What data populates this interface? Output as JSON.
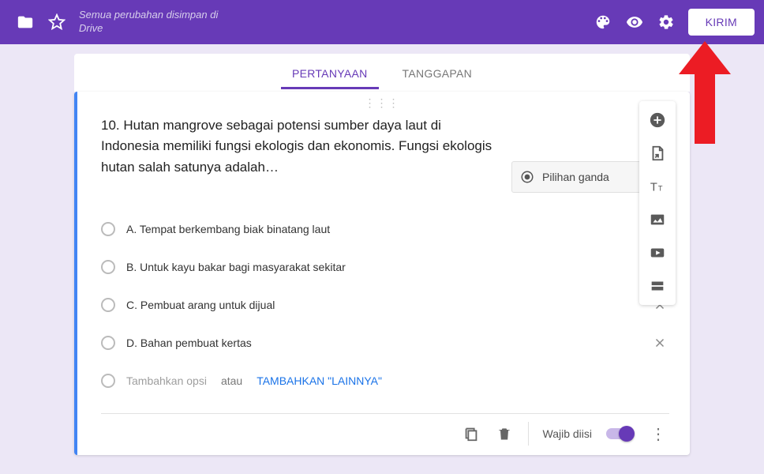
{
  "header": {
    "status_text": "Semua perubahan disimpan di Drive",
    "send_label": "KIRIM"
  },
  "tabs": {
    "questions": "PERTANYAAN",
    "responses": "TANGGAPAN"
  },
  "question": {
    "text": "10. Hutan mangrove sebagai potensi sumber daya laut di Indonesia memiliki fungsi ekologis dan ekonomis. Fungsi ekologis hutan salah satunya adalah…",
    "type_label": "Pilihan ganda",
    "options": [
      "A. Tempat berkembang biak binatang laut",
      "B. Untuk kayu bakar bagi masyarakat sekitar",
      "C. Pembuat arang untuk dijual",
      "D. Bahan pembuat kertas"
    ],
    "add_option_placeholder": "Tambahkan opsi",
    "add_option_or": "atau",
    "add_other_label": "TAMBAHKAN \"LAINNYA\""
  },
  "footer": {
    "required_label": "Wajib diisi"
  },
  "colors": {
    "accent": "#673ab7",
    "arrow": "#ec1c24"
  }
}
